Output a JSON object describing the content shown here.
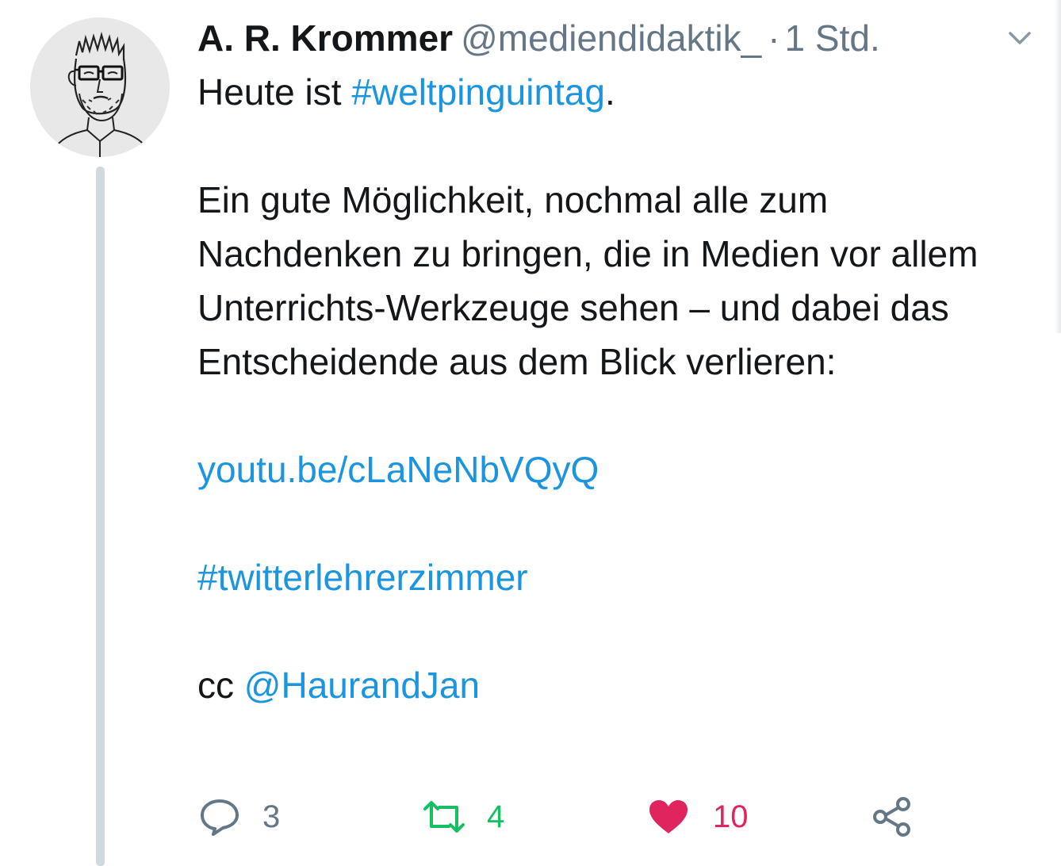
{
  "tweet": {
    "author": {
      "name": "A. R. Krommer",
      "handle": "@mediendidaktik_",
      "separator": "·",
      "time": "1 Std."
    },
    "lines": {
      "line1_prefix": "Heute ist ",
      "line1_hashtag": "#weltpinguintag",
      "line1_suffix": ".",
      "paragraph": "Ein gute Möglichkeit, nochmal alle zum Nachdenken zu bringen, die in Medien vor allem Unterrichts-Werkzeuge sehen – und dabei das Entscheidende aus dem Blick verlieren:",
      "link": "youtu.be/cLaNeNbVQyQ",
      "hashtag2": "#twitterlehrerzimmer",
      "cc_prefix": "cc ",
      "cc_mention": "@HaurandJan"
    },
    "actions": {
      "replies": "3",
      "retweets": "4",
      "likes": "10"
    }
  },
  "icons": {
    "caret": "chevron-down-icon",
    "reply": "reply-icon",
    "retweet": "retweet-icon",
    "like": "heart-icon",
    "share": "share-icon"
  },
  "colors": {
    "text": "#14171a",
    "secondary": "#657786",
    "link": "#1b95e0",
    "retweet": "#17bf63",
    "like": "#e0245e",
    "thread_line": "#cfd9de"
  }
}
